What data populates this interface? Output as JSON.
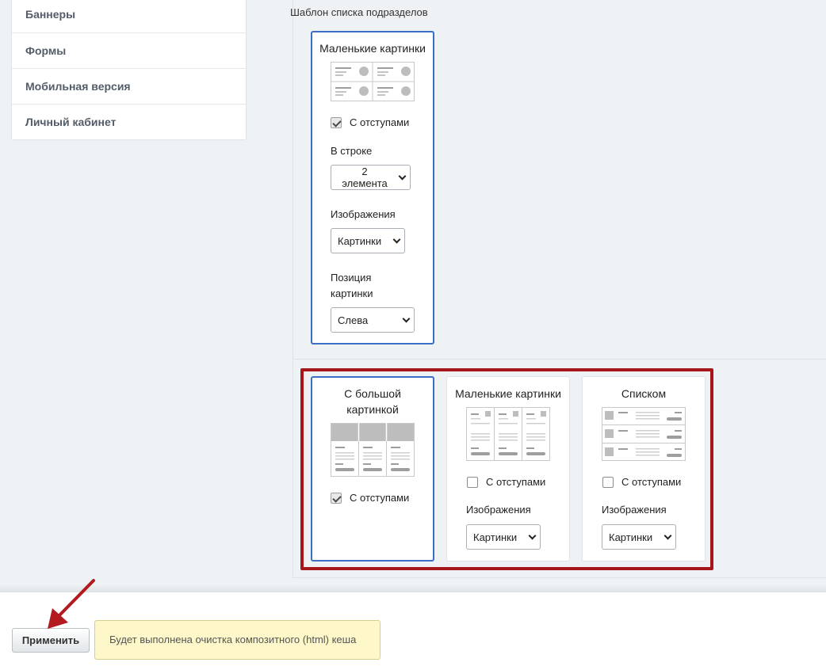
{
  "sidebar": {
    "items": [
      {
        "label": "Баннеры"
      },
      {
        "label": "Формы"
      },
      {
        "label": "Мобильная версия"
      },
      {
        "label": "Личный кабинет"
      }
    ]
  },
  "subsection_template": {
    "label": "Шаблон списка подразделов",
    "card": {
      "title": "Маленькие картинки",
      "indent_label": "С отступами",
      "indent_checked": true,
      "per_row_label": "В строке",
      "per_row_value": "2 элемента",
      "images_label": "Изображения",
      "images_value": "Картинки",
      "image_position_label": "Позиция картинки",
      "image_position_value": "Слева",
      "selected": true
    }
  },
  "list_templates": [
    {
      "title": "С большой картинкой",
      "indent_label": "С отступами",
      "indent_checked": true,
      "selected": true
    },
    {
      "title": "Маленькие картинки",
      "indent_label": "С отступами",
      "indent_checked": false,
      "images_label": "Изображения",
      "images_value": "Картинки",
      "selected": false
    },
    {
      "title": "Списком",
      "indent_label": "С отступами",
      "indent_checked": false,
      "images_label": "Изображения",
      "images_value": "Картинки",
      "selected": false
    }
  ],
  "footer": {
    "apply_label": "Применить",
    "notice": "Будет выполнена очистка композитного (html) кеша"
  },
  "colors": {
    "selected_border": "#3a6fc5",
    "highlight": "#a6161b",
    "notice_bg": "#fdf7c9"
  }
}
